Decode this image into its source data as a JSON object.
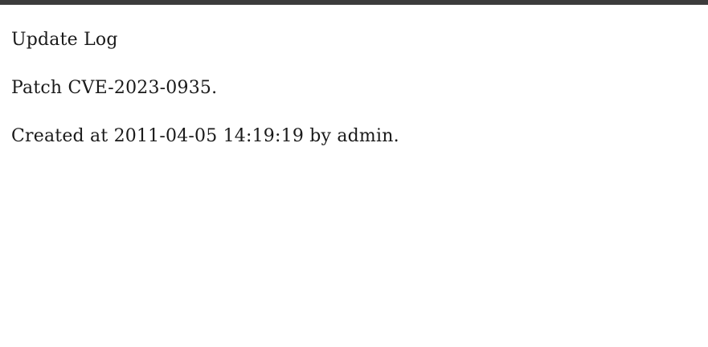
{
  "log": {
    "title": "Update Log",
    "message": "Patch CVE-2023-0935.",
    "meta": "Created at 2011-04-05 14:19:19 by admin."
  },
  "colors": {
    "top_bar": "#3c3c3c",
    "background": "#ffffff",
    "text": "#1a1a1a"
  }
}
